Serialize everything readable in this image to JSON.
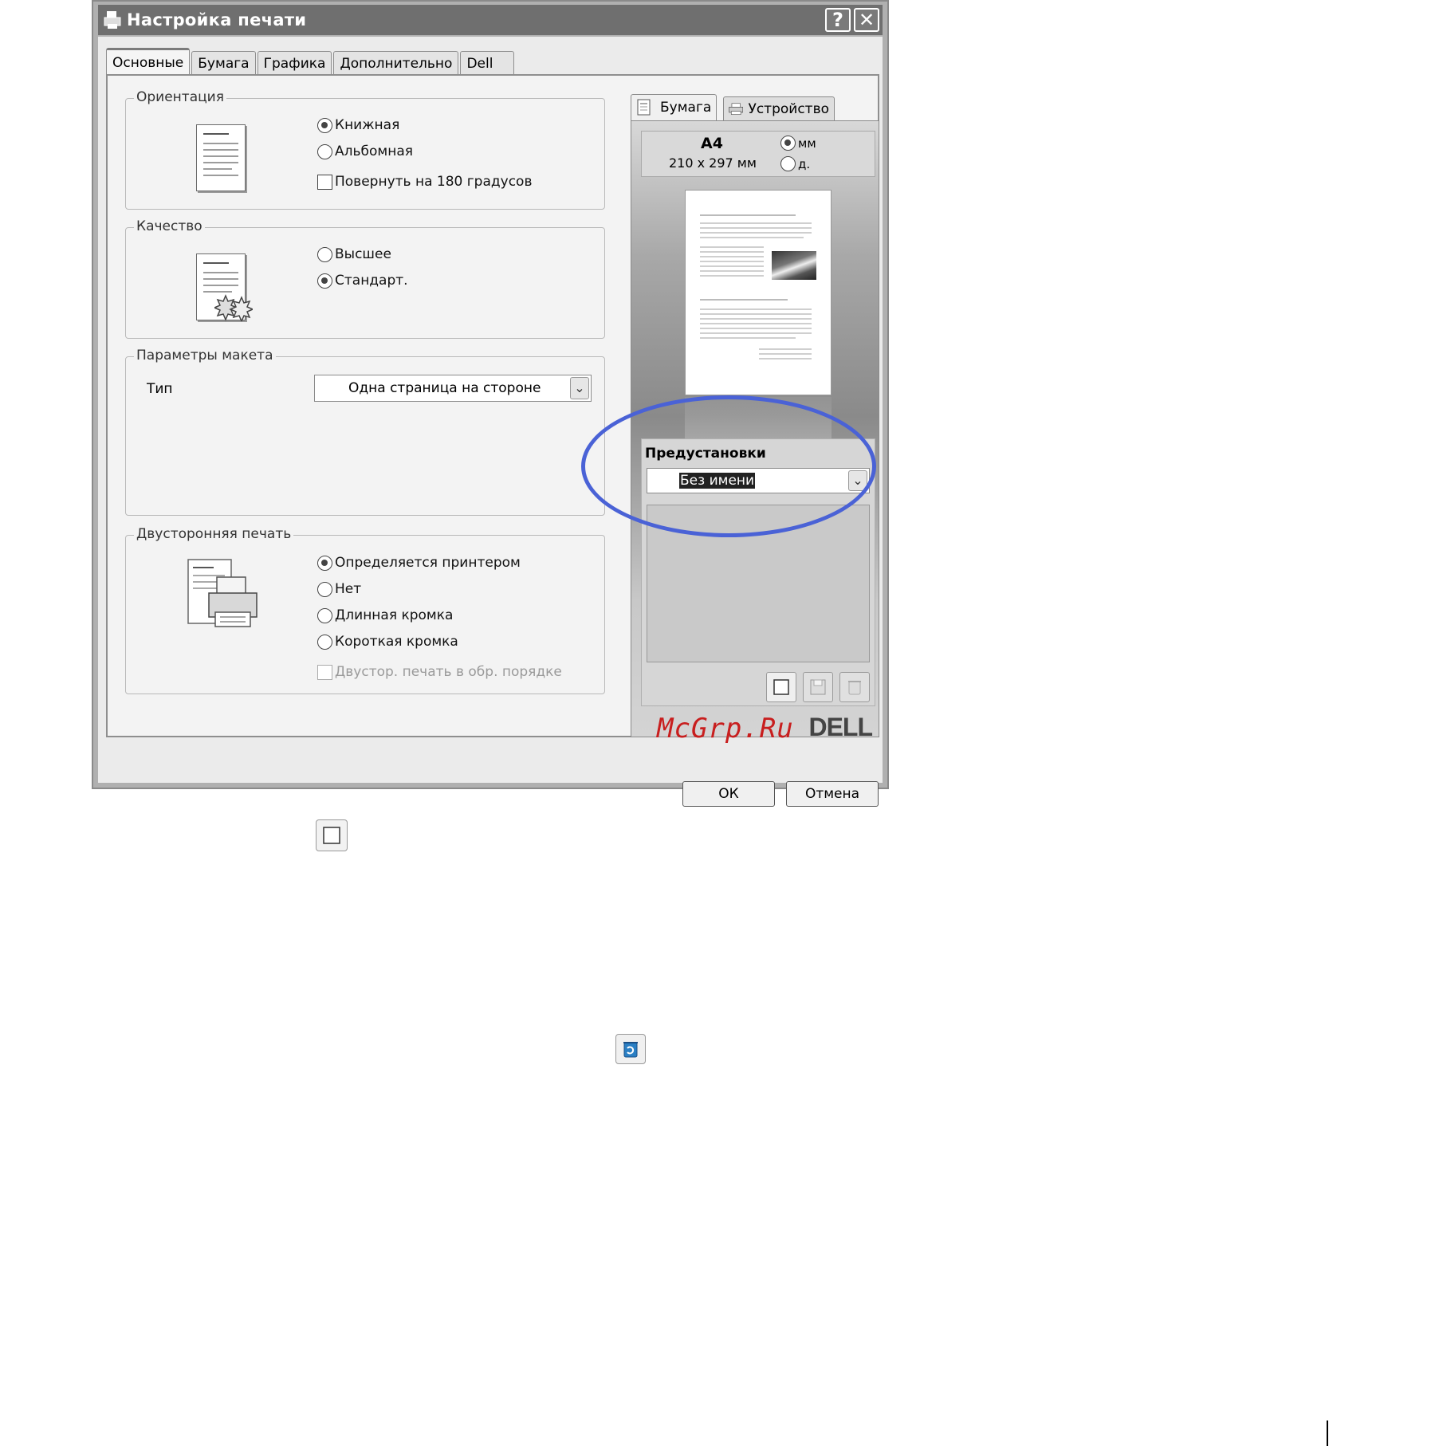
{
  "window": {
    "title": "Настройка печати",
    "help_label": "?",
    "close_label": "✕"
  },
  "tabs": [
    "Основные",
    "Бумага",
    "Графика",
    "Дополнительно",
    "Dell"
  ],
  "orientation": {
    "legend": "Ориентация",
    "options": [
      "Книжная",
      "Альбомная"
    ],
    "selected": "Книжная",
    "rotate_label": "Повернуть на 180 градусов",
    "rotate_checked": false
  },
  "quality": {
    "legend": "Качество",
    "options": [
      "Высшее",
      "Стандарт."
    ],
    "selected": "Стандарт."
  },
  "layout": {
    "legend": "Параметры макета",
    "type_label": "Тип",
    "type_value": "Одна страница на стороне"
  },
  "duplex": {
    "legend": "Двусторонняя печать",
    "options": [
      "Определяется принтером",
      "Нет",
      "Длинная кромка",
      "Короткая кромка"
    ],
    "selected": "Определяется принтером",
    "reverse_label": "Двустор. печать в обр. порядке",
    "reverse_enabled": false
  },
  "preview": {
    "tabs": [
      "Бумага",
      "Устройство"
    ],
    "paper_name": "A4",
    "paper_size": "210 x 297 мм",
    "units": [
      "мм",
      "д."
    ],
    "selected_unit": "мм"
  },
  "presets": {
    "title": "Предустановки",
    "value": "Без имени"
  },
  "branding": {
    "watermark": "McGrp.Ru",
    "logo": "DELL",
    "highlight_color": "#4a62d6"
  },
  "buttons": {
    "ok": "ОК",
    "cancel": "Отмена"
  }
}
